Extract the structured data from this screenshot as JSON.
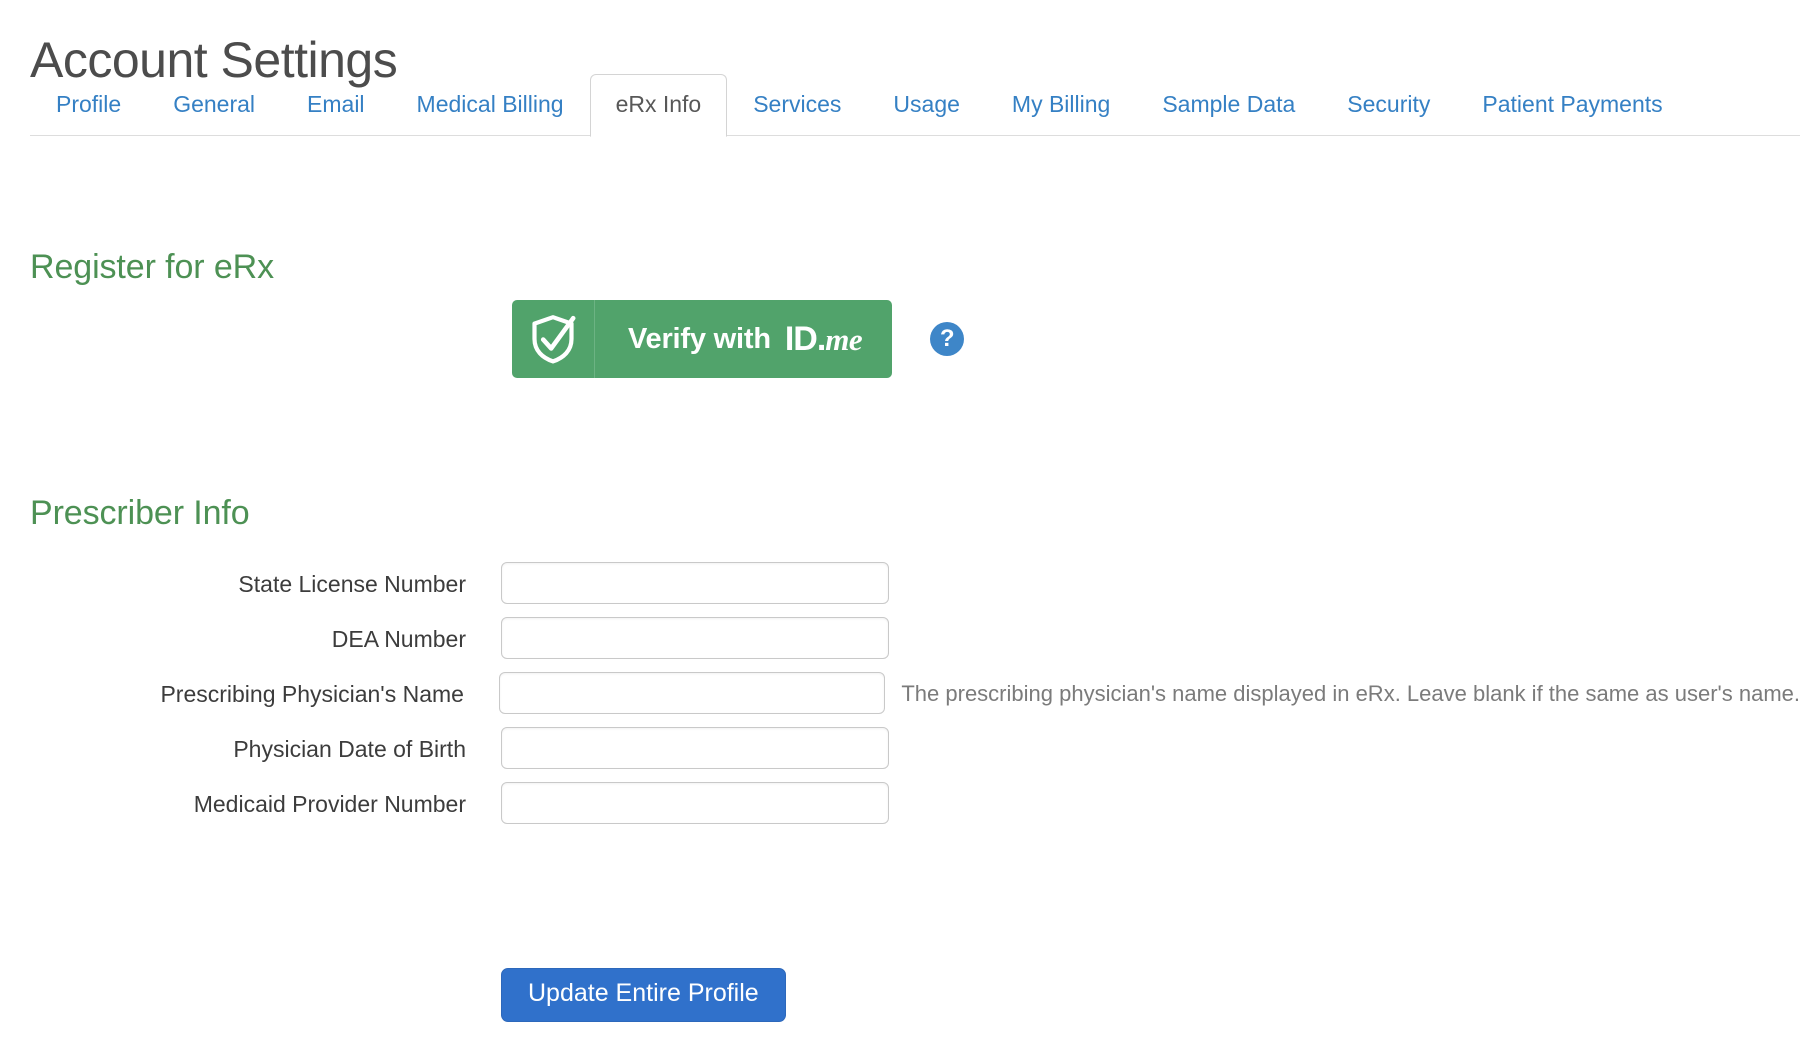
{
  "page": {
    "title": "Account Settings"
  },
  "tabs": [
    {
      "label": "Profile",
      "active": false
    },
    {
      "label": "General",
      "active": false
    },
    {
      "label": "Email",
      "active": false
    },
    {
      "label": "Medical Billing",
      "active": false
    },
    {
      "label": "eRx Info",
      "active": true
    },
    {
      "label": "Services",
      "active": false
    },
    {
      "label": "Usage",
      "active": false
    },
    {
      "label": "My Billing",
      "active": false
    },
    {
      "label": "Sample Data",
      "active": false
    },
    {
      "label": "Security",
      "active": false
    },
    {
      "label": "Patient Payments",
      "active": false
    }
  ],
  "sections": {
    "register": {
      "heading": "Register for eRx",
      "verify_button": {
        "prefix": "Verify with",
        "brand_id": "ID",
        "brand_dot": ".",
        "brand_me": "me",
        "shield_icon": "shield-check-icon",
        "background_color": "#51a36b"
      },
      "help": {
        "icon": "question-circle-icon",
        "glyph": "?",
        "color": "#3e86c8"
      }
    },
    "prescriber": {
      "heading": "Prescriber Info",
      "fields": [
        {
          "label": "State License Number",
          "value": "",
          "placeholder": "",
          "help": ""
        },
        {
          "label": "DEA Number",
          "value": "",
          "placeholder": "",
          "help": ""
        },
        {
          "label": "Prescribing Physician's Name",
          "value": "",
          "placeholder": "",
          "help": "The prescribing physician's name displayed in eRx. Leave blank if the same as user's name."
        },
        {
          "label": "Physician Date of Birth",
          "value": "",
          "placeholder": "",
          "help": ""
        },
        {
          "label": "Medicaid Provider Number",
          "value": "",
          "placeholder": "",
          "help": ""
        }
      ]
    }
  },
  "actions": {
    "submit_label": "Update Entire Profile",
    "submit_color": "#3071cb"
  },
  "colors": {
    "heading_green": "#4d9154",
    "link_blue": "#3580c4",
    "title_gray": "#4c4c4c",
    "border_gray": "#dddddd"
  }
}
